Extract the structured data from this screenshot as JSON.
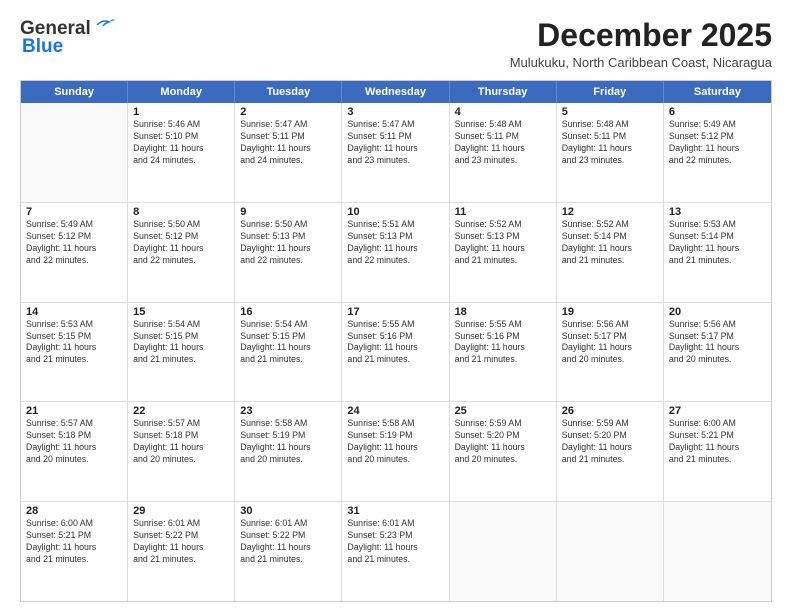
{
  "logo": {
    "line1": "General",
    "line2": "Blue"
  },
  "title": "December 2025",
  "subtitle": "Mulukuku, North Caribbean Coast, Nicaragua",
  "days_header": [
    "Sunday",
    "Monday",
    "Tuesday",
    "Wednesday",
    "Thursday",
    "Friday",
    "Saturday"
  ],
  "weeks": [
    [
      {
        "day": "",
        "info": ""
      },
      {
        "day": "1",
        "info": "Sunrise: 5:46 AM\nSunset: 5:10 PM\nDaylight: 11 hours\nand 24 minutes."
      },
      {
        "day": "2",
        "info": "Sunrise: 5:47 AM\nSunset: 5:11 PM\nDaylight: 11 hours\nand 24 minutes."
      },
      {
        "day": "3",
        "info": "Sunrise: 5:47 AM\nSunset: 5:11 PM\nDaylight: 11 hours\nand 23 minutes."
      },
      {
        "day": "4",
        "info": "Sunrise: 5:48 AM\nSunset: 5:11 PM\nDaylight: 11 hours\nand 23 minutes."
      },
      {
        "day": "5",
        "info": "Sunrise: 5:48 AM\nSunset: 5:11 PM\nDaylight: 11 hours\nand 23 minutes."
      },
      {
        "day": "6",
        "info": "Sunrise: 5:49 AM\nSunset: 5:12 PM\nDaylight: 11 hours\nand 22 minutes."
      }
    ],
    [
      {
        "day": "7",
        "info": "Sunrise: 5:49 AM\nSunset: 5:12 PM\nDaylight: 11 hours\nand 22 minutes."
      },
      {
        "day": "8",
        "info": "Sunrise: 5:50 AM\nSunset: 5:12 PM\nDaylight: 11 hours\nand 22 minutes."
      },
      {
        "day": "9",
        "info": "Sunrise: 5:50 AM\nSunset: 5:13 PM\nDaylight: 11 hours\nand 22 minutes."
      },
      {
        "day": "10",
        "info": "Sunrise: 5:51 AM\nSunset: 5:13 PM\nDaylight: 11 hours\nand 22 minutes."
      },
      {
        "day": "11",
        "info": "Sunrise: 5:52 AM\nSunset: 5:13 PM\nDaylight: 11 hours\nand 21 minutes."
      },
      {
        "day": "12",
        "info": "Sunrise: 5:52 AM\nSunset: 5:14 PM\nDaylight: 11 hours\nand 21 minutes."
      },
      {
        "day": "13",
        "info": "Sunrise: 5:53 AM\nSunset: 5:14 PM\nDaylight: 11 hours\nand 21 minutes."
      }
    ],
    [
      {
        "day": "14",
        "info": "Sunrise: 5:53 AM\nSunset: 5:15 PM\nDaylight: 11 hours\nand 21 minutes."
      },
      {
        "day": "15",
        "info": "Sunrise: 5:54 AM\nSunset: 5:15 PM\nDaylight: 11 hours\nand 21 minutes."
      },
      {
        "day": "16",
        "info": "Sunrise: 5:54 AM\nSunset: 5:15 PM\nDaylight: 11 hours\nand 21 minutes."
      },
      {
        "day": "17",
        "info": "Sunrise: 5:55 AM\nSunset: 5:16 PM\nDaylight: 11 hours\nand 21 minutes."
      },
      {
        "day": "18",
        "info": "Sunrise: 5:55 AM\nSunset: 5:16 PM\nDaylight: 11 hours\nand 21 minutes."
      },
      {
        "day": "19",
        "info": "Sunrise: 5:56 AM\nSunset: 5:17 PM\nDaylight: 11 hours\nand 20 minutes."
      },
      {
        "day": "20",
        "info": "Sunrise: 5:56 AM\nSunset: 5:17 PM\nDaylight: 11 hours\nand 20 minutes."
      }
    ],
    [
      {
        "day": "21",
        "info": "Sunrise: 5:57 AM\nSunset: 5:18 PM\nDaylight: 11 hours\nand 20 minutes."
      },
      {
        "day": "22",
        "info": "Sunrise: 5:57 AM\nSunset: 5:18 PM\nDaylight: 11 hours\nand 20 minutes."
      },
      {
        "day": "23",
        "info": "Sunrise: 5:58 AM\nSunset: 5:19 PM\nDaylight: 11 hours\nand 20 minutes."
      },
      {
        "day": "24",
        "info": "Sunrise: 5:58 AM\nSunset: 5:19 PM\nDaylight: 11 hours\nand 20 minutes."
      },
      {
        "day": "25",
        "info": "Sunrise: 5:59 AM\nSunset: 5:20 PM\nDaylight: 11 hours\nand 20 minutes."
      },
      {
        "day": "26",
        "info": "Sunrise: 5:59 AM\nSunset: 5:20 PM\nDaylight: 11 hours\nand 21 minutes."
      },
      {
        "day": "27",
        "info": "Sunrise: 6:00 AM\nSunset: 5:21 PM\nDaylight: 11 hours\nand 21 minutes."
      }
    ],
    [
      {
        "day": "28",
        "info": "Sunrise: 6:00 AM\nSunset: 5:21 PM\nDaylight: 11 hours\nand 21 minutes."
      },
      {
        "day": "29",
        "info": "Sunrise: 6:01 AM\nSunset: 5:22 PM\nDaylight: 11 hours\nand 21 minutes."
      },
      {
        "day": "30",
        "info": "Sunrise: 6:01 AM\nSunset: 5:22 PM\nDaylight: 11 hours\nand 21 minutes."
      },
      {
        "day": "31",
        "info": "Sunrise: 6:01 AM\nSunset: 5:23 PM\nDaylight: 11 hours\nand 21 minutes."
      },
      {
        "day": "",
        "info": ""
      },
      {
        "day": "",
        "info": ""
      },
      {
        "day": "",
        "info": ""
      }
    ]
  ]
}
